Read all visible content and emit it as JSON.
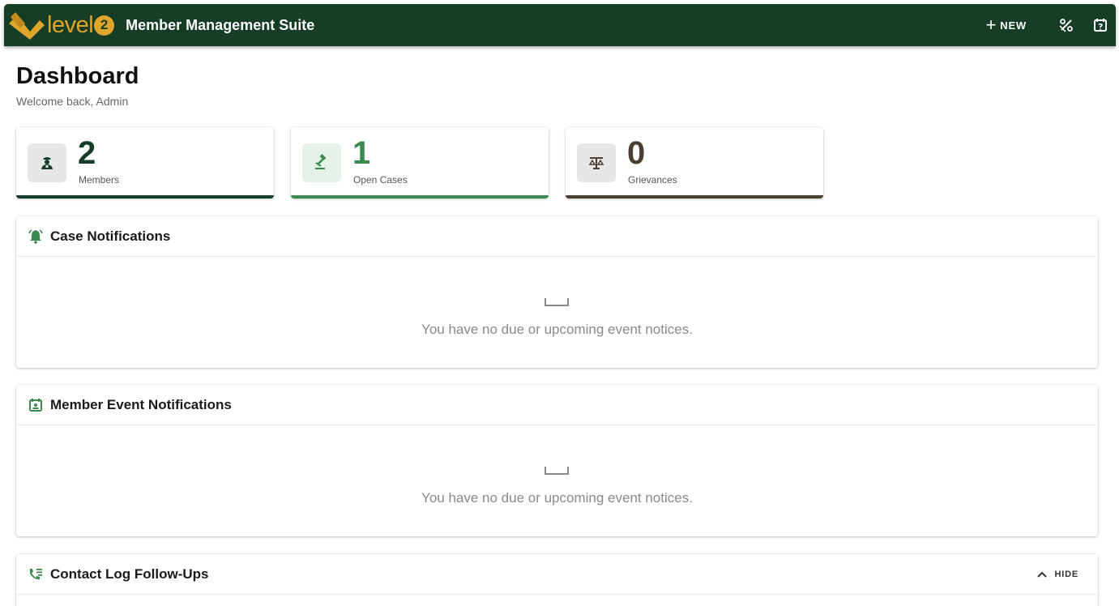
{
  "appbar": {
    "logo_text": "level",
    "logo_badge": "2",
    "title": "Member Management Suite",
    "new_label": "NEW",
    "icons": [
      "logo-icon",
      "plus-icon",
      "percent-icon",
      "calendar-icon"
    ]
  },
  "page": {
    "title": "Dashboard",
    "subtitle": "Welcome back, Admin"
  },
  "stats": [
    {
      "value": "2",
      "label": "Members",
      "icon": "member-icon",
      "color": "#163d26",
      "icon_bg": "#e6e8e7"
    },
    {
      "value": "1",
      "label": "Open Cases",
      "icon": "gavel-icon",
      "color": "#3a8a4f",
      "icon_bg": "#e6f1e8"
    },
    {
      "value": "0",
      "label": "Grievances",
      "icon": "scale-icon",
      "color": "#4b3f31",
      "icon_bg": "#e9e7e5"
    }
  ],
  "panels": {
    "case_notifications": {
      "title": "Case Notifications",
      "icon": "bell-icon",
      "empty_message": "You have no due or upcoming event notices."
    },
    "member_event_notifications": {
      "title": "Member Event Notifications",
      "icon": "calendar-event-icon",
      "empty_message": "You have no due or upcoming event notices."
    },
    "contact_log": {
      "title": "Contact Log Follow-Ups",
      "icon": "phone-list-icon",
      "hide_label": "HIDE"
    }
  },
  "colors": {
    "appbar": "#163d26",
    "brand_gold": "#e0a52b",
    "accent_green": "#3a8a4f"
  }
}
